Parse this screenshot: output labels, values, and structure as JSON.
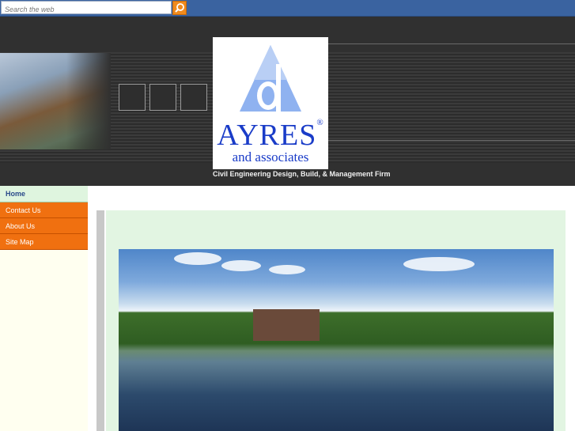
{
  "search": {
    "placeholder": "Search the web",
    "button_icon": "search-icon"
  },
  "logo": {
    "name": "AYRES",
    "registered": "®",
    "sub": "and associates"
  },
  "header": {
    "tagline": "Civil Engineering Design, Build, & Management Firm"
  },
  "nav": {
    "items": [
      {
        "label": "Home",
        "active": true
      },
      {
        "label": "Contact Us",
        "active": false
      },
      {
        "label": "About Us",
        "active": false
      },
      {
        "label": "Site Map",
        "active": false
      }
    ]
  },
  "colors": {
    "topbar": "#3a63a0",
    "nav_orange": "#f07010",
    "panel_green": "#e2f5e2",
    "logo_blue": "#1a3cc8"
  }
}
